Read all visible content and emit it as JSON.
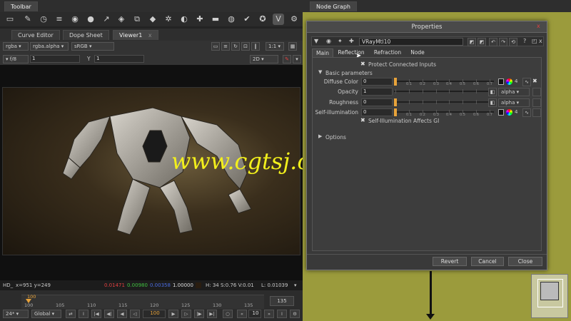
{
  "top_tabs": {
    "toolbar": "Toolbar",
    "node_graph": "Node Graph",
    "close_glyph": "x"
  },
  "viewer_tabs": [
    {
      "label": "Curve Editor"
    },
    {
      "label": "Dope Sheet"
    },
    {
      "label": "Viewer1"
    }
  ],
  "viewer_controls": {
    "channels": "rgba",
    "alpha_channel": "rgba.alpha",
    "colorspace": "sRGB",
    "zoom": "1:1",
    "fstop": "f/8",
    "gain": "1",
    "y_label": "Y",
    "gamma": "1",
    "view_mode": "2D"
  },
  "status_bar": {
    "mode": "HD_",
    "coords": "x=951 y=249",
    "r": "0.01471",
    "g": "0.00980",
    "b": "0.00358",
    "a": "1.00000",
    "hsv": "H: 34 S:0.76 V:0.01",
    "luma": "L: 0.01039"
  },
  "timeline": {
    "current_frame": "100",
    "ticks": [
      "100",
      "105",
      "110",
      "115",
      "120",
      "125",
      "130",
      "135"
    ],
    "end_frame": "135",
    "fps": "24*",
    "range_mode": "Global",
    "step": "10"
  },
  "watermark": "www.cgtsj.com",
  "properties": {
    "title": "Properties",
    "node_name": "VRayMtl10",
    "tabs": [
      {
        "label": "Main"
      },
      {
        "label": "Reflection"
      },
      {
        "label": "Refraction"
      },
      {
        "label": "Node"
      }
    ],
    "protect_inputs": "Protect Connected Inputs",
    "basic_section": "Basic parameters",
    "params": [
      {
        "label": "Diffuse Color",
        "value": "0",
        "level": 0
      },
      {
        "label": "Opacity",
        "value": "1",
        "level": 1,
        "dropdown": "alpha"
      },
      {
        "label": "Roughness",
        "value": "0",
        "level": 0,
        "dropdown": "alpha"
      },
      {
        "label": "Self-illumination",
        "value": "0",
        "level": 0
      }
    ],
    "scale_ticks": [
      "0",
      "0.1",
      "0.2",
      "0.3",
      "0.4",
      "0.5",
      "0.6",
      "0.7"
    ],
    "channel_count": "4",
    "self_illum_gi": "Self-Illumination Affects GI",
    "options_section": "Options",
    "buttons": {
      "revert": "Revert",
      "cancel": "Cancel",
      "close": "Close"
    }
  },
  "colors": {
    "node_graph_bg": "#9b9b3c",
    "slider_knob": "#e8a33a",
    "watermark": "#f2ef1c",
    "red": "#e04040",
    "green": "#40c040",
    "blue": "#4a6ae0"
  }
}
